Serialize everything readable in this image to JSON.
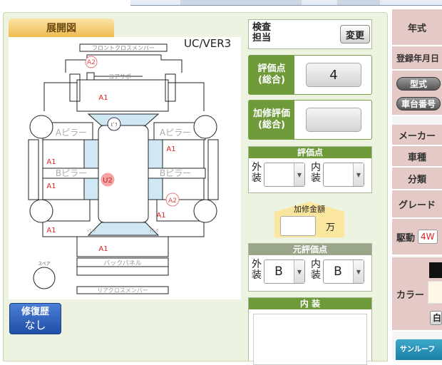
{
  "diagram": {
    "tab_label": "展開図",
    "version": "UC/VER3",
    "parts": {
      "front_cross_member": "フロントクロスメンバー",
      "core_support": "コアサポ",
      "a_pillar_left": "Aピラー",
      "a_pillar_right": "Aピラー",
      "b_pillar_left": "Bピラー",
      "b_pillar_right": "Bピラー",
      "back_panel": "バックパネル",
      "rear_cross_member": "リアクロスメンバー",
      "spare": "スペア",
      "roof_mark": "ﾋﾟﾗ",
      "rear_left_mark": "ﾄﾗﾝｸ",
      "rear_right_mark": "ﾄﾗﾝｸ"
    },
    "marks": {
      "front_a2": "A2",
      "bonnet_a1": "A1",
      "left_front_a1": "A1",
      "left_mid_a1": "A1",
      "u2": "U2",
      "right_front_a1": "A1",
      "right_mid_a2": "A2",
      "right_rear_a1": "A1",
      "left_rear_a1": "A1",
      "trunk_a1": "A1"
    }
  },
  "repair_history": {
    "label": "修復歴",
    "value": "なし"
  },
  "inspector": {
    "label_line1": "検査",
    "label_line2": "担当",
    "change_button": "変更"
  },
  "score_total": {
    "label_line1": "評価点",
    "label_line2": "(総合)",
    "value": "4"
  },
  "repair_score": {
    "label_line1": "加修評価",
    "label_line2": "(総合)",
    "value": ""
  },
  "rating": {
    "header": "評価点",
    "exterior_label_1": "外",
    "exterior_label_2": "装",
    "exterior_value": "",
    "interior_label_1": "内",
    "interior_label_2": "装",
    "interior_value": ""
  },
  "repair_amount": {
    "label": "加修金額",
    "value": "",
    "unit": "万"
  },
  "original_rating": {
    "header": "元評価点",
    "exterior_label_1": "外",
    "exterior_label_2": "装",
    "exterior_value": "B",
    "interior_label_1": "内",
    "interior_label_2": "装",
    "interior_value": "B"
  },
  "interior": {
    "header": "内 装"
  },
  "right_panel": {
    "year": "年式",
    "registration": "登録年月日",
    "model_button": "型式",
    "chassis_button": "車台番号",
    "maker": "メーカー",
    "vehicle": "車種",
    "category": "分類",
    "grade": "グレード",
    "drive": "駆動",
    "drive_value": "4W",
    "color": "カラー",
    "color_button": "白",
    "sunroof": "サンルーフ"
  }
}
